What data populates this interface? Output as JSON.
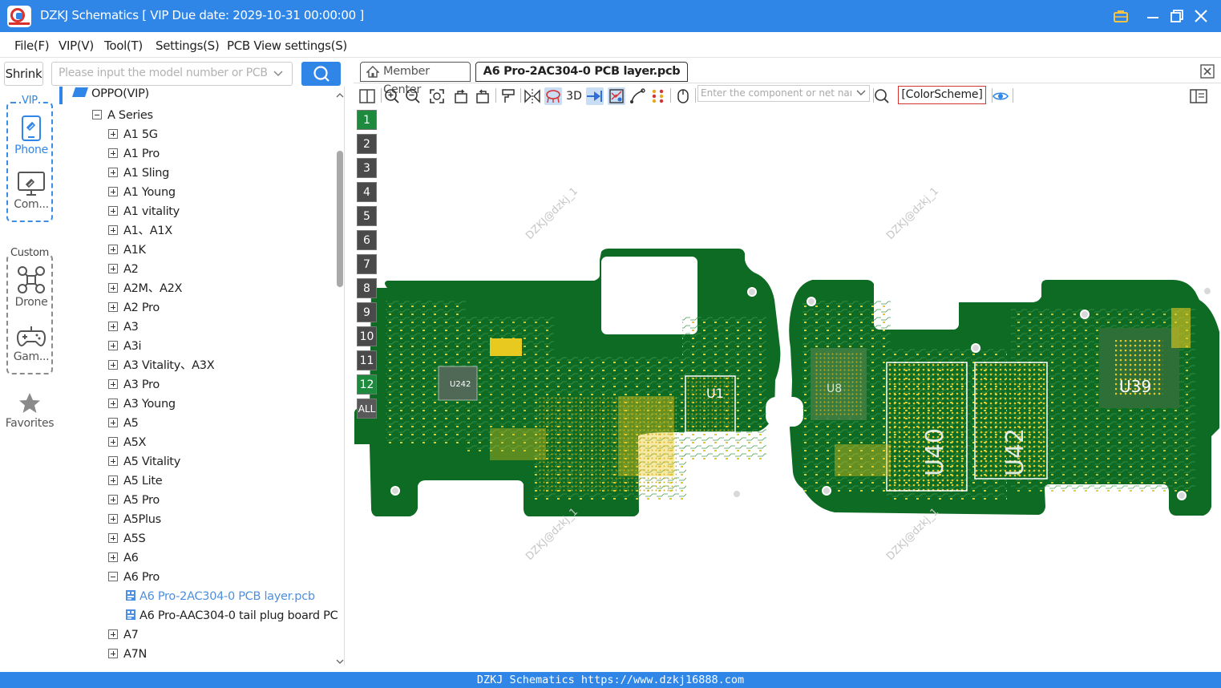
{
  "window": {
    "title": "DZKJ Schematics [ VIP Due date: 2029-10-31 00:00:00 ]"
  },
  "menu": [
    "File(F)",
    "VIP(V)",
    "Tool(T)",
    "Settings(S)",
    "PCB View settings(S)"
  ],
  "sidebar": {
    "shrink_label": "Shrink",
    "search_placeholder": "Please input the model number or PCB",
    "vip_group_label": "VIP",
    "custom_group_label": "Custom",
    "items": {
      "phone": "Phone",
      "computer": "Com...",
      "drone": "Drone",
      "game": "Gam...",
      "favorites": "Favorites"
    }
  },
  "tree": {
    "root": "OPPO(VIP)",
    "series": "A Series",
    "models": [
      "A1 5G",
      "A1 Pro",
      "A1 Sling",
      "A1 Young",
      "A1 vitality",
      "A1、A1X",
      "A1K",
      "A2",
      "A2M、A2X",
      "A2 Pro",
      "A3",
      "A3i",
      "A3 Vitality、A3X",
      "A3 Pro",
      "A3 Young",
      "A5",
      "A5X",
      "A5 Vitality",
      "A5 Lite",
      "A5 Pro",
      "A5Plus",
      "A5S",
      "A6",
      "A6 Pro"
    ],
    "files": [
      "A6 Pro-2AC304-0 PCB layer.pcb",
      "A6 Pro-AAC304-0 tail plug board PC"
    ],
    "models_after": [
      "A7",
      "A7N"
    ]
  },
  "tabs": {
    "member_center": "Member Center",
    "active_file": "A6 Pro-2AC304-0 PCB layer.pcb"
  },
  "toolbar": {
    "three_d": "3D",
    "component_search_placeholder": "Enter the component or net nan",
    "color_scheme": "[ColorScheme]"
  },
  "layers": [
    "1",
    "2",
    "3",
    "4",
    "5",
    "6",
    "7",
    "8",
    "9",
    "10",
    "11",
    "12",
    "ALL"
  ],
  "pcb": {
    "watermark": "DZKJ@dzkj_1",
    "labels": [
      "U242",
      "U1",
      "U8",
      "U40",
      "U42",
      "U39"
    ],
    "colors": {
      "board": "#0e6b23",
      "copper": "#e8c91f",
      "silk": "#ffffff"
    }
  },
  "status": {
    "text": "DZKJ Schematics https://www.dzkj16888.com"
  }
}
